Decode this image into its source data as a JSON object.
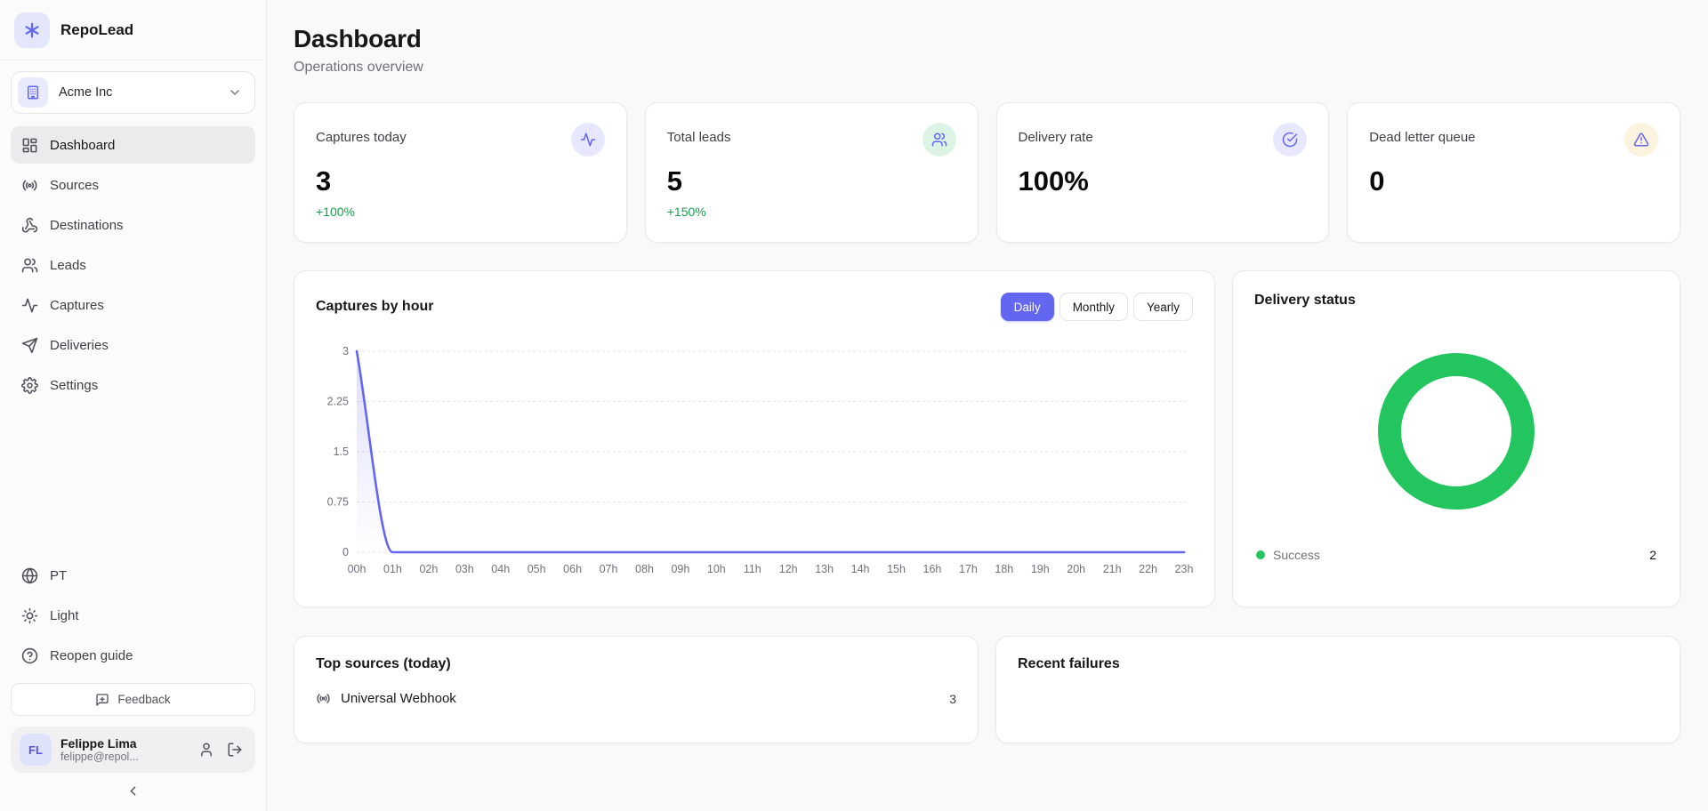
{
  "app": {
    "name": "RepoLead"
  },
  "colors": {
    "accent": "#6366f1",
    "accent_soft": "#e7e8fd",
    "success": "#22c55e",
    "delta_green": "#16a34a",
    "mint_bg": "#ddf3e4",
    "cream_bg": "#fbf3dd"
  },
  "sidebar": {
    "org": {
      "name": "Acme Inc",
      "icon": "building-icon"
    },
    "nav": [
      {
        "label": "Dashboard",
        "icon": "layout-dashboard-icon",
        "active": true
      },
      {
        "label": "Sources",
        "icon": "radio-icon",
        "active": false
      },
      {
        "label": "Destinations",
        "icon": "webhook-icon",
        "active": false
      },
      {
        "label": "Leads",
        "icon": "users-icon",
        "active": false
      },
      {
        "label": "Captures",
        "icon": "activity-icon",
        "active": false
      },
      {
        "label": "Deliveries",
        "icon": "send-icon",
        "active": false
      },
      {
        "label": "Settings",
        "icon": "settings-icon",
        "active": false
      }
    ],
    "footer": [
      {
        "label": "PT",
        "icon": "globe-icon"
      },
      {
        "label": "Light",
        "icon": "sun-icon"
      },
      {
        "label": "Reopen guide",
        "icon": "help-circle-icon"
      }
    ],
    "feedback_label": "Feedback",
    "user": {
      "initials": "FL",
      "name": "Felippe Lima",
      "email": "felippe@repol..."
    }
  },
  "header": {
    "title": "Dashboard",
    "subtitle": "Operations overview"
  },
  "stats": [
    {
      "label": "Captures today",
      "value": "3",
      "delta": "+100%",
      "icon": "activity-icon"
    },
    {
      "label": "Total leads",
      "value": "5",
      "delta": "+150%",
      "icon": "users-icon"
    },
    {
      "label": "Delivery rate",
      "value": "100%",
      "delta": "",
      "icon": "circle-check-icon"
    },
    {
      "label": "Dead letter queue",
      "value": "0",
      "delta": "",
      "icon": "triangle-alert-icon"
    }
  ],
  "captures_chart": {
    "title": "Captures by hour",
    "toggles": [
      "Daily",
      "Monthly",
      "Yearly"
    ],
    "active_toggle": "Daily"
  },
  "delivery_status": {
    "title": "Delivery status",
    "legend": [
      {
        "label": "Success",
        "value": "2",
        "color": "#22c55e"
      }
    ]
  },
  "top_sources": {
    "title": "Top sources (today)",
    "rows": [
      {
        "icon": "radio-icon",
        "label": "Universal Webhook",
        "value": "3"
      }
    ]
  },
  "recent_failures": {
    "title": "Recent failures"
  },
  "chart_data": [
    {
      "type": "line",
      "title": "Captures by hour",
      "x": [
        "00h",
        "01h",
        "02h",
        "03h",
        "04h",
        "05h",
        "06h",
        "07h",
        "08h",
        "09h",
        "10h",
        "11h",
        "12h",
        "13h",
        "14h",
        "15h",
        "16h",
        "17h",
        "18h",
        "19h",
        "20h",
        "21h",
        "22h",
        "23h"
      ],
      "series": [
        {
          "name": "Captures",
          "values": [
            3,
            0,
            0,
            0,
            0,
            0,
            0,
            0,
            0,
            0,
            0,
            0,
            0,
            0,
            0,
            0,
            0,
            0,
            0,
            0,
            0,
            0,
            0,
            0
          ]
        }
      ],
      "ylim": [
        0,
        3
      ],
      "yticks": [
        0,
        0.75,
        1.5,
        2.25,
        3
      ],
      "xlabel": "",
      "ylabel": "",
      "line_color": "#6366f1",
      "area_fill": true,
      "grid": "horizontal-dashed",
      "legend_position": "none"
    },
    {
      "type": "pie",
      "title": "Delivery status",
      "labels": [
        "Success"
      ],
      "values": [
        2
      ],
      "colors": [
        "#22c55e"
      ],
      "donut": true,
      "legend_position": "bottom"
    }
  ]
}
